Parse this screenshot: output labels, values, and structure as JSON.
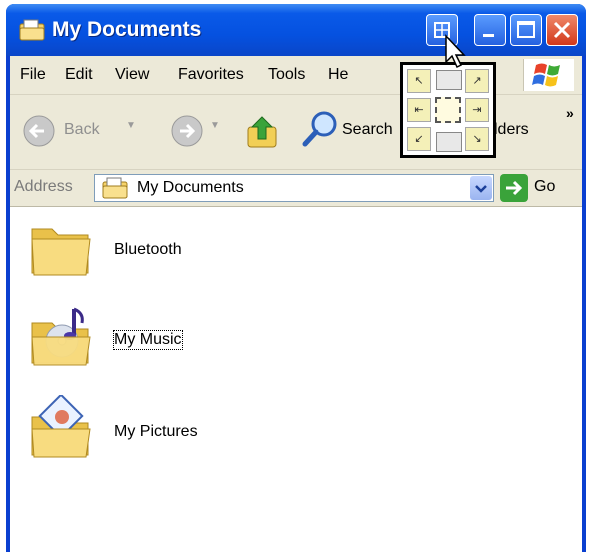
{
  "window": {
    "title": "My Documents"
  },
  "menu": {
    "file": "File",
    "edit": "Edit",
    "view": "View",
    "favorites": "Favorites",
    "tools": "Tools",
    "help": "He"
  },
  "toolbar": {
    "back": "Back",
    "search": "Search",
    "folders": "lders"
  },
  "address": {
    "label": "Address",
    "value": "My Documents",
    "go": "Go"
  },
  "items": [
    {
      "label": "Bluetooth",
      "icon": "folder-icon"
    },
    {
      "label": "My Music",
      "icon": "music-folder-icon"
    },
    {
      "label": "My Pictures",
      "icon": "pictures-folder-icon"
    }
  ],
  "colors": {
    "titlebar": "#0551e0",
    "chrome": "#ece9d8",
    "accent": "#3aa33a"
  }
}
